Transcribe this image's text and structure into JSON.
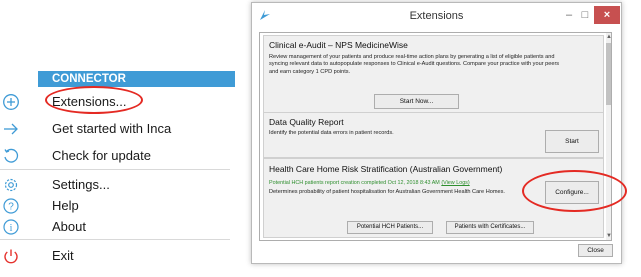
{
  "menu": {
    "header": "CONNECTOR",
    "items": [
      {
        "label": "Extensions...",
        "icon": "plus-circle-icon"
      },
      {
        "label": "Get started with Inca",
        "icon": "arrow-right-icon"
      },
      {
        "label": "Check for update",
        "icon": "refresh-icon"
      },
      {
        "label": "Settings...",
        "icon": "gear-icon"
      },
      {
        "label": "Help",
        "icon": "question-icon"
      },
      {
        "label": "About",
        "icon": "info-icon"
      },
      {
        "label": "Exit",
        "icon": "power-icon"
      }
    ]
  },
  "window": {
    "title": "Extensions",
    "controls": {
      "minimize": "–",
      "maximize": "□",
      "close": "×"
    },
    "close_label": "Close"
  },
  "extensions": [
    {
      "title": "Clinical e-Audit – NPS MedicineWise",
      "description": "Review management of your patients and produce real-time action plans by generating a list of eligible patients and syncing relevant data to autopopulate responses to Clinical e-Audit questions. Compare your practice with your peers and earn category 1 CPD points.",
      "button": "Start Now..."
    },
    {
      "title": "Data Quality Report",
      "description": "Identify the potential data errors in patient records.",
      "button": "Start"
    },
    {
      "title": "Health Care Home Risk Stratification (Australian Government)",
      "status": "Potential HCH patients report creation completed Oct 12, 2018 8:43 AM",
      "status_link": "(View Logs)",
      "description": "Determines probability of patient hospitalisation for Australian Government Health Care Homes.",
      "button": "Configure...",
      "button_patients": "Potential HCH Patients...",
      "button_certificates": "Patients with Certificates..."
    }
  ],
  "colors": {
    "menu_header_bg": "#3f9bd6",
    "menu_icon": "#3f9bd6",
    "exit_icon": "#e5322d",
    "annotation": "#e42a23",
    "status_text": "#2f8f2f",
    "close_button": "#c75050"
  }
}
